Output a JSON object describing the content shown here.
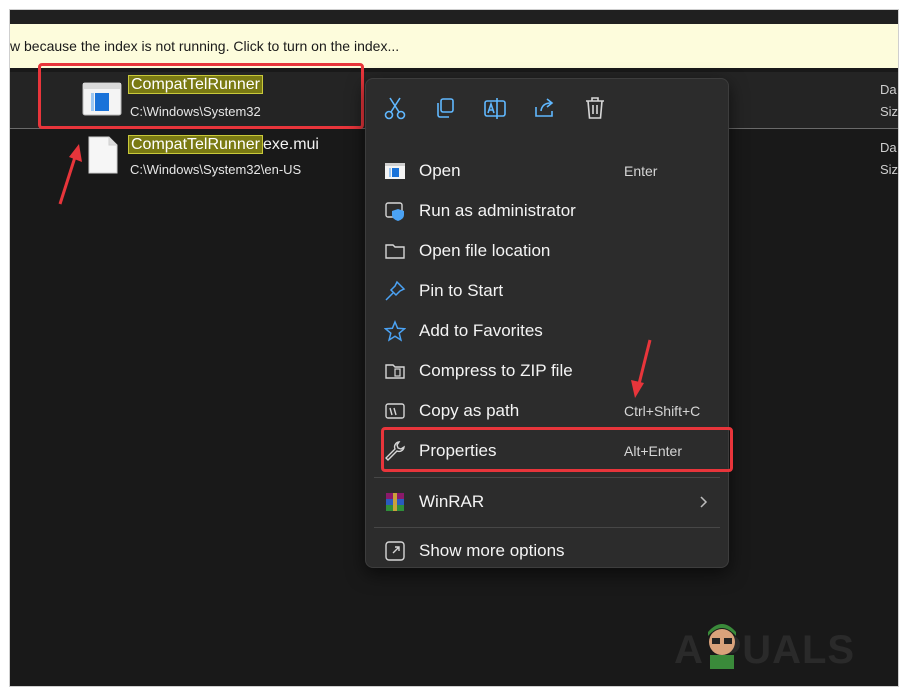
{
  "infobar": {
    "text": "w because the index is not running.  Click to turn on the index..."
  },
  "results": [
    {
      "name_highlight": "CompatTelRunner",
      "name_rest": "",
      "path": "C:\\Windows\\System32",
      "col_date": "Da",
      "col_size": "Siz"
    },
    {
      "name_highlight": "CompatTelRunner",
      "name_rest": "exe.mui",
      "path": "C:\\Windows\\System32\\en-US",
      "col_date": "Da",
      "col_size": "Siz"
    }
  ],
  "toolbar": {
    "cut_icon": "scissors-icon",
    "copy_icon": "copy-icon",
    "rename_icon": "rename-icon",
    "share_icon": "share-icon",
    "delete_icon": "trash-icon"
  },
  "menu": {
    "items": [
      {
        "label": "Open",
        "shortcut": "Enter",
        "icon": "open-icon"
      },
      {
        "label": "Run as administrator",
        "shortcut": "",
        "icon": "shield-icon"
      },
      {
        "label": "Open file location",
        "shortcut": "",
        "icon": "folder-icon"
      },
      {
        "label": "Pin to Start",
        "shortcut": "",
        "icon": "pin-icon"
      },
      {
        "label": "Add to Favorites",
        "shortcut": "",
        "icon": "star-icon"
      },
      {
        "label": "Compress to ZIP file",
        "shortcut": "",
        "icon": "zip-icon"
      },
      {
        "label": "Copy as path",
        "shortcut": "Ctrl+Shift+C",
        "icon": "copy-path-icon"
      },
      {
        "label": "Properties",
        "shortcut": "Alt+Enter",
        "icon": "wrench-icon"
      }
    ],
    "winrar": {
      "label": "WinRAR",
      "icon": "winrar-icon"
    },
    "more": {
      "label": "Show more options",
      "icon": "more-options-icon"
    }
  },
  "watermark": {
    "text": "A  PUALS"
  },
  "colors": {
    "annotation": "#e8353b",
    "highlight": "#7a7a13",
    "menu_bg": "#2c2c2c",
    "accent": "#4ba3f5"
  }
}
